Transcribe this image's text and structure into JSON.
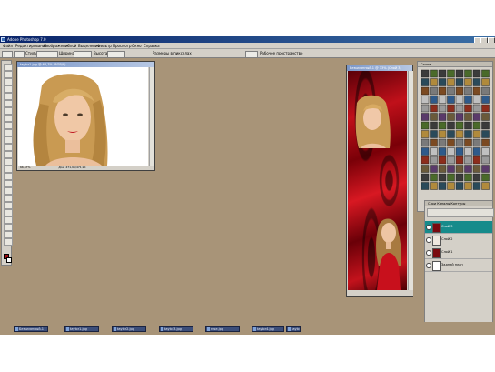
{
  "window": {
    "title": "Adobe Photoshop 7.0"
  },
  "menu": [
    "Файл",
    "Редактирование",
    "Изображение",
    "Слой",
    "Выделение",
    "Фильтр",
    "Просмотр",
    "Окно",
    "Справка"
  ],
  "options_bar": {
    "labels": [
      "Стиль",
      "Ширина",
      "Высота",
      "Размеры в пикселах",
      "Рабочее пространство"
    ]
  },
  "doc1": {
    "title": "taylor1.jpg @ 66,7% (RGB/8)",
    "zoom": "66,67%",
    "doc_size": "Док: 471,9K/471,9K"
  },
  "doc2": {
    "title": "Безымянный-1 @ 33% (Слой 3, RGB/8)"
  },
  "swatches_panel": {
    "tab": "Стили"
  },
  "layers_panel": {
    "tabs": "Слои  Каналы  Контуры",
    "layers": [
      {
        "name": "Слой 3",
        "active": true
      },
      {
        "name": "Слой 2",
        "active": false
      },
      {
        "name": "Слой 1",
        "active": false
      },
      {
        "name": "Задний план",
        "active": false
      }
    ]
  },
  "taskbar": {
    "items": [
      "Безымянный-1",
      "taylor1.jpg",
      "taylor2.jpg",
      "taylor3.jpg",
      "rose.jpg",
      "taylor4.jpg",
      "taylor5.jpg"
    ]
  },
  "colors": {
    "foreground": "#9c0c12",
    "background": "#ffffff",
    "workspace": "#a89478",
    "layer_active": "#168b8b"
  }
}
